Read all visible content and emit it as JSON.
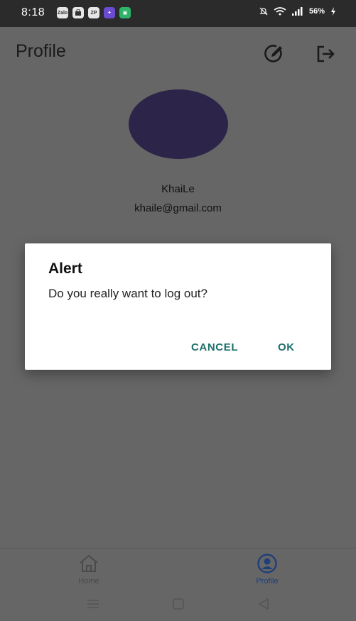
{
  "status_bar": {
    "time": "8:18",
    "battery": "56%",
    "notifications": [
      {
        "icon": "messenger-icon",
        "label": "Zalo"
      },
      {
        "icon": "shopping-bag-icon",
        "label": ""
      },
      {
        "icon": "zp-app-icon",
        "label": "ZP"
      },
      {
        "icon": "game-app-icon",
        "label": ""
      },
      {
        "icon": "store-app-icon",
        "label": ""
      }
    ]
  },
  "header": {
    "title": "Profile"
  },
  "profile": {
    "name": "KhaiLe",
    "email": "khaile@gmail.com",
    "avatar_color": "#2c2449"
  },
  "dialog": {
    "title": "Alert",
    "message": "Do you really want to log out?",
    "cancel_label": "CANCEL",
    "ok_label": "OK",
    "button_color": "#1d6f6a"
  },
  "bottom_nav": {
    "items": [
      {
        "label": "Home",
        "icon": "home-icon",
        "active": false
      },
      {
        "label": "Profile",
        "icon": "account-circle-icon",
        "active": true
      }
    ]
  }
}
